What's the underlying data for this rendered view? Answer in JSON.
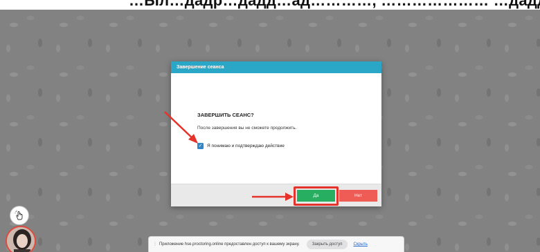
{
  "top_caption": "…Ыл…дадр…дадд…ад…………, ………………… …дадд",
  "dialog": {
    "header": "Завершение сеанса",
    "title": "ЗАВЕРШИТЬ СЕАНС?",
    "text": "После завершения вы не сможете продолжить.",
    "checkbox_label": "Я понимаю и подтверждаю действие",
    "checkbox_checked": true,
    "yes_label": "Да",
    "no_label": "Нет"
  },
  "colors": {
    "header": "#2aa6c6",
    "yes": "#27ae60",
    "no": "#ef5b55",
    "annotation": "#e5322b"
  },
  "share_bar": {
    "text": "Приложение hse.proctoring.online предоставлен доступ к вашему экрану.",
    "stop_label": "Закрыть доступ",
    "hide_label": "Скрыть"
  },
  "icons": {
    "hand": "raise-hand-icon",
    "avatar": "user-avatar"
  }
}
